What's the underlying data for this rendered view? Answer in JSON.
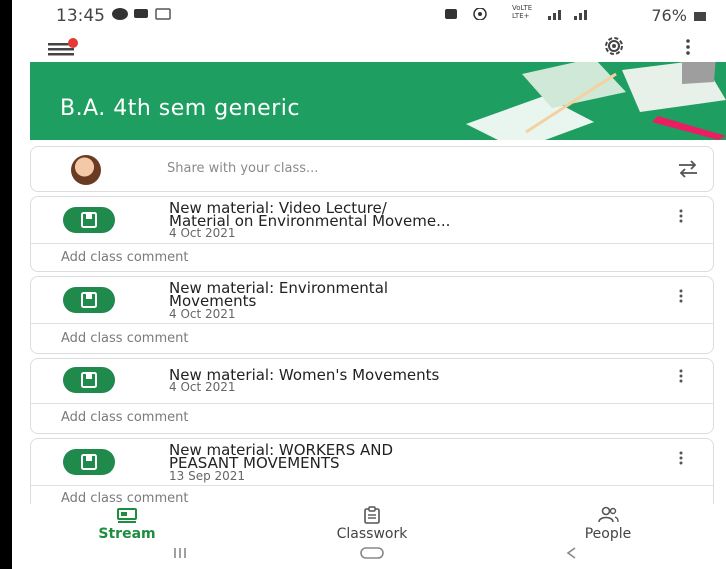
{
  "status_bar": {
    "time": "13:45",
    "network": "VoLTE LTE+",
    "battery": "76%"
  },
  "class": {
    "title": "B.A. 4th sem generic"
  },
  "share": {
    "placeholder": "Share with your class..."
  },
  "posts": [
    {
      "title_line1": "New material: Video Lecture/",
      "title_line2": "Material on Environmental Moveme...",
      "date": "4 Oct 2021",
      "comment": "Add class comment"
    },
    {
      "title_line1": "New material: Environmental",
      "title_line2": "Movements",
      "date": "4 Oct 2021",
      "comment": "Add class comment"
    },
    {
      "title_line1": "New material: Women's Movements",
      "title_line2": "",
      "date": "4 Oct 2021",
      "comment": "Add class comment"
    },
    {
      "title_line1": "New material: WORKERS AND",
      "title_line2": "PEASANT MOVEMENTS",
      "date": "13 Sep 2021",
      "comment": "Add class comment"
    }
  ],
  "bottom_nav": {
    "stream": "Stream",
    "classwork": "Classwork",
    "people": "People"
  },
  "colors": {
    "accent": "#1f9e62",
    "icon_green": "#1f8a4c",
    "active_tab": "#1e8e3e"
  },
  "icons": [
    "menu-icon",
    "gear-icon",
    "more-vert-icon",
    "swap-icon",
    "material-icon",
    "stream-icon",
    "classwork-icon",
    "people-icon"
  ]
}
